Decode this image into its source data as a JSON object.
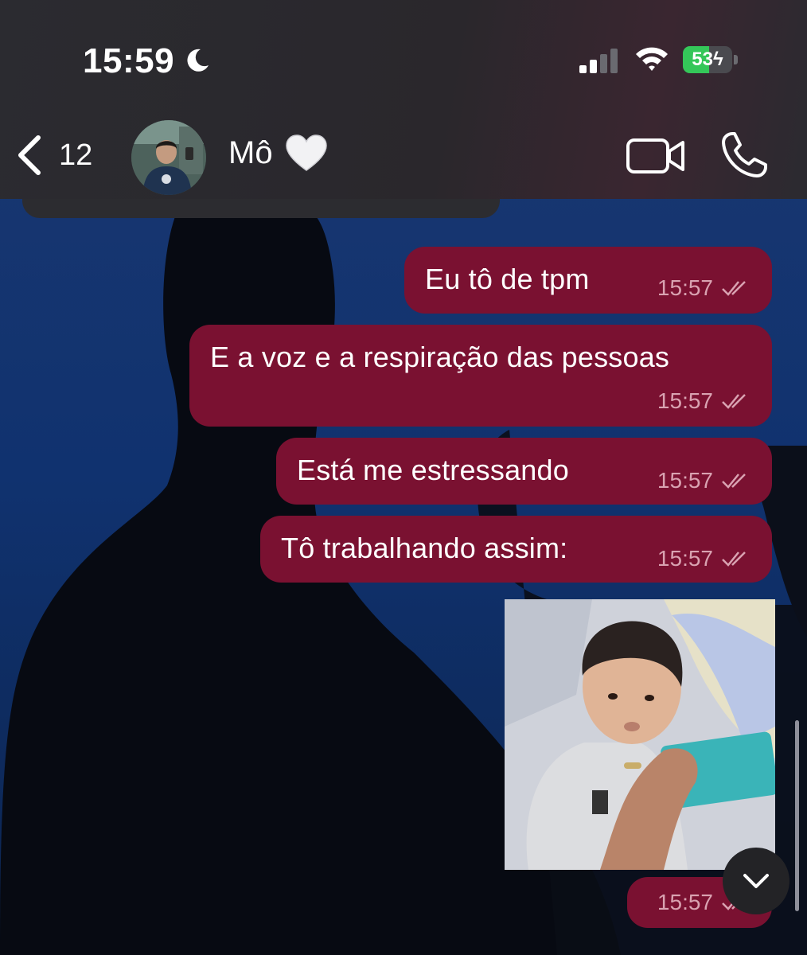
{
  "status_bar": {
    "time": "15:59",
    "battery_percent": "53",
    "battery_level": 0.53,
    "moon_icon": "moon-icon",
    "signal_icon": "cellular-signal-icon",
    "wifi_icon": "wifi-icon",
    "battery_icon": "battery-charging-icon"
  },
  "header": {
    "back_count": "12",
    "contact_name": "Mô",
    "contact_emoji": "🤍",
    "video_icon": "video-camera-icon",
    "call_icon": "phone-icon"
  },
  "messages": [
    {
      "text": "Eu tô de tpm",
      "time": "15:57",
      "status": "read"
    },
    {
      "text": "E a voz e a respiração das pessoas",
      "time": "15:57",
      "status": "read"
    },
    {
      "text": "Está me estressando",
      "time": "15:57",
      "status": "read"
    },
    {
      "text": "Tô trabalhando assim:",
      "time": "15:57",
      "status": "read"
    },
    {
      "type": "image",
      "time": "15:57",
      "status": "read"
    }
  ],
  "colors": {
    "outgoing_bubble": "#7a1131",
    "header_bg": "#2b2b30",
    "battery_fill": "#34c759"
  }
}
